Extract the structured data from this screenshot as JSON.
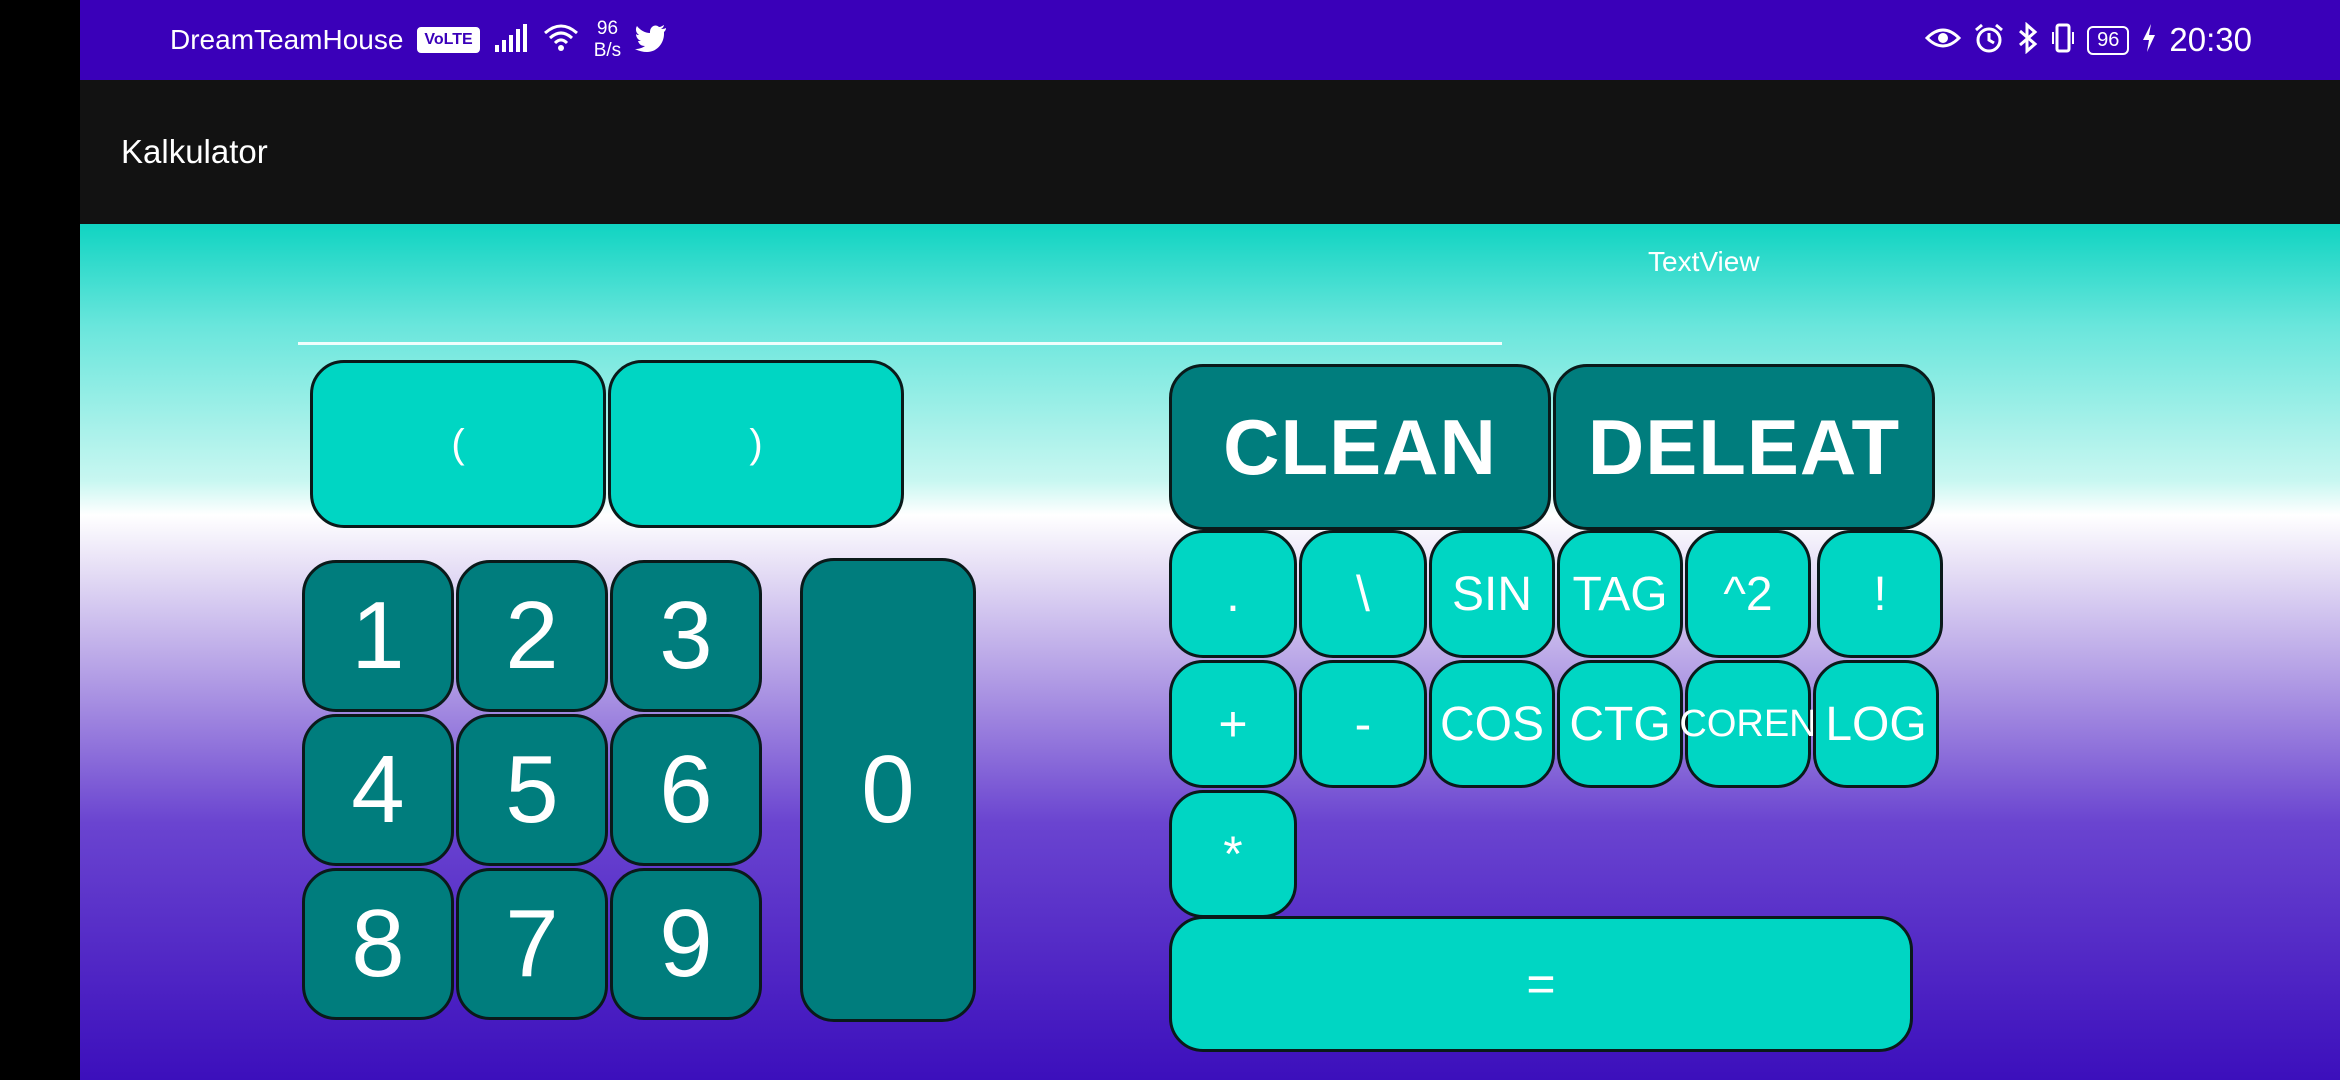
{
  "status_bar": {
    "carrier": "DreamTeamHouse",
    "volte": "VoLTE",
    "net_speed_value": "96",
    "net_speed_unit": "B/s",
    "battery_level": "96",
    "time": "20:30",
    "icons": [
      "signal-icon",
      "wifi-icon",
      "twitter-icon",
      "eye-icon",
      "alarm-icon",
      "bluetooth-icon",
      "vibrate-icon",
      "battery-icon",
      "charging-icon"
    ]
  },
  "app_bar": {
    "title": "Kalkulator"
  },
  "display": {
    "text_view": "TextView",
    "input_value": ""
  },
  "buttons": {
    "paren_open": "(",
    "paren_close": ")",
    "n1": "1",
    "n2": "2",
    "n3": "3",
    "n4": "4",
    "n5": "5",
    "n6": "6",
    "n8": "8",
    "n7": "7",
    "n9": "9",
    "n0": "0",
    "clean": "CLEAN",
    "deleat": "DELEAT",
    "dot": ".",
    "backslash": "\\",
    "sin": "SIN",
    "tag": "TAG",
    "square": "^2",
    "factorial": "!",
    "plus": "+",
    "minus": "-",
    "cos": "COS",
    "ctg": "CTG",
    "coren": "COREN",
    "log": "LOG",
    "multiply": "*",
    "equals": "="
  },
  "colors": {
    "status_bar": "#3a00b9",
    "app_bar": "#121212",
    "button_teal": "#00d6c3",
    "button_dark": "#007d7d"
  }
}
